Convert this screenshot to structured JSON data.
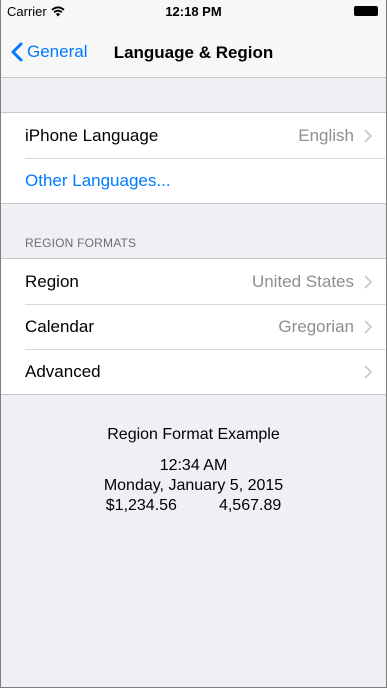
{
  "status_bar": {
    "carrier": "Carrier",
    "time": "12:18 PM"
  },
  "nav": {
    "back_label": "General",
    "title": "Language & Region"
  },
  "language_group": {
    "iphone_language": {
      "label": "iPhone Language",
      "value": "English"
    },
    "other_languages": {
      "label": "Other Languages..."
    }
  },
  "region_formats": {
    "header": "REGION FORMATS",
    "rows": [
      {
        "label": "Region",
        "value": "United States"
      },
      {
        "label": "Calendar",
        "value": "Gregorian"
      },
      {
        "label": "Advanced",
        "value": ""
      }
    ]
  },
  "example": {
    "title": "Region Format Example",
    "time": "12:34 AM",
    "date": "Monday, January 5, 2015",
    "currency": "$1,234.56",
    "number": "4,567.89"
  },
  "colors": {
    "accent": "#007aff",
    "secondary_text": "#8e8e93",
    "background": "#efeff4"
  }
}
